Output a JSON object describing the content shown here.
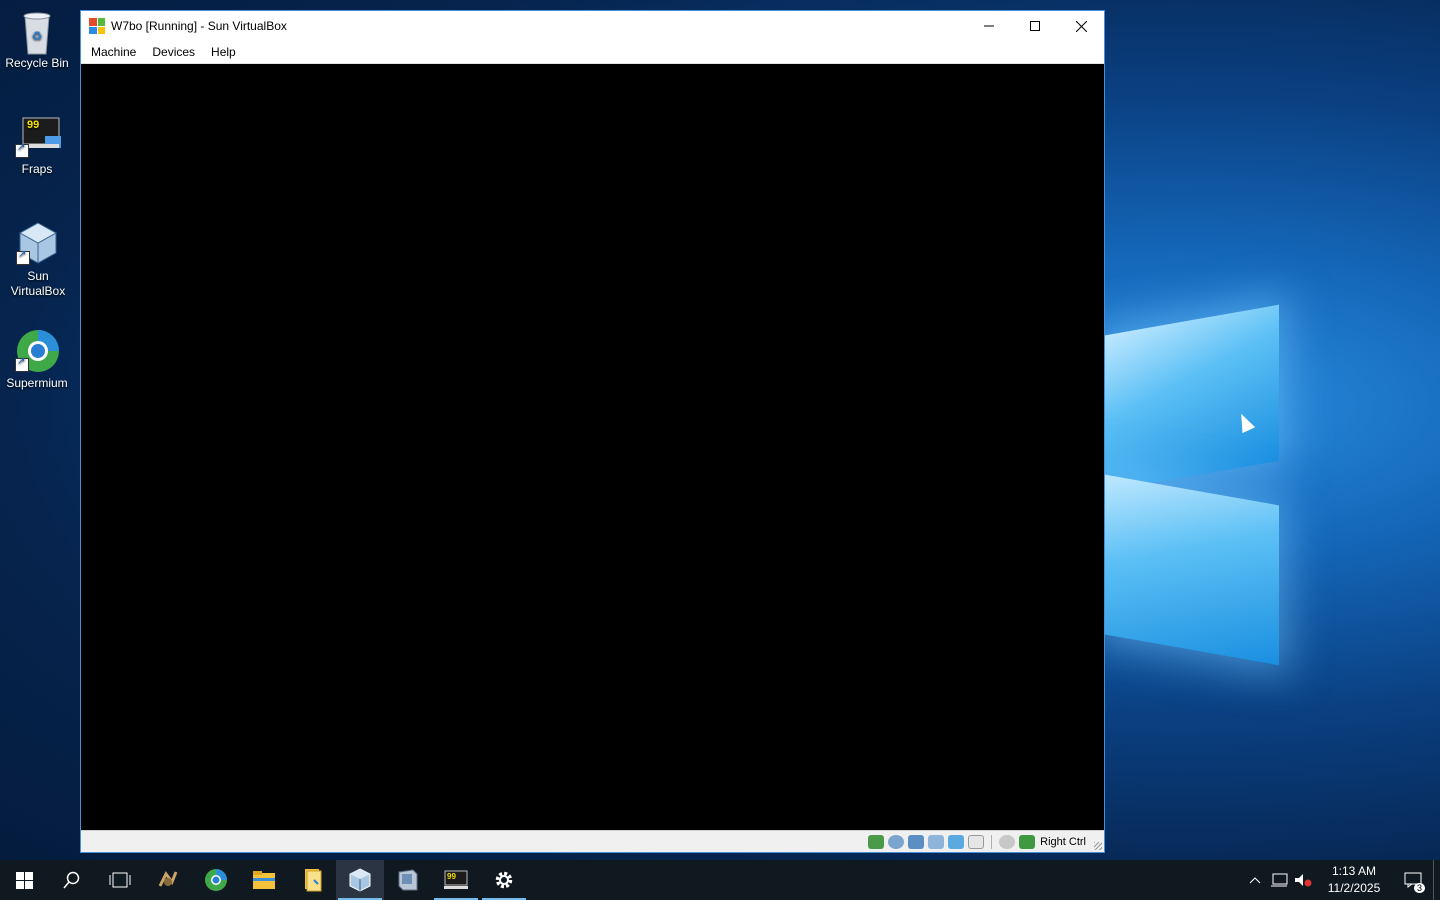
{
  "desktop": {
    "icons": [
      {
        "label": "Recycle Bin"
      },
      {
        "label": "Fraps"
      },
      {
        "label": "Sun VirtualBox"
      },
      {
        "label": "Supermium"
      }
    ]
  },
  "window": {
    "title": "W7bo [Running] - Sun VirtualBox",
    "menu": [
      "Machine",
      "Devices",
      "Help"
    ],
    "status": {
      "host_key": "Right Ctrl"
    }
  },
  "taskbar": {
    "items": [
      "start-icon",
      "search-icon",
      "task-view-icon",
      "pinned-app-icon",
      "supermium-icon",
      "file-explorer-icon",
      "documents-icon",
      "virtualbox-icon",
      "virtual-pc-icon",
      "fraps-icon",
      "settings-icon"
    ],
    "clock": {
      "time": "1:13 AM",
      "date": "11/2/2025"
    },
    "notifications": "3"
  },
  "colors": {
    "taskbar": "#101820",
    "accent": "#76b9ed",
    "window_border": "#4a90d9"
  }
}
